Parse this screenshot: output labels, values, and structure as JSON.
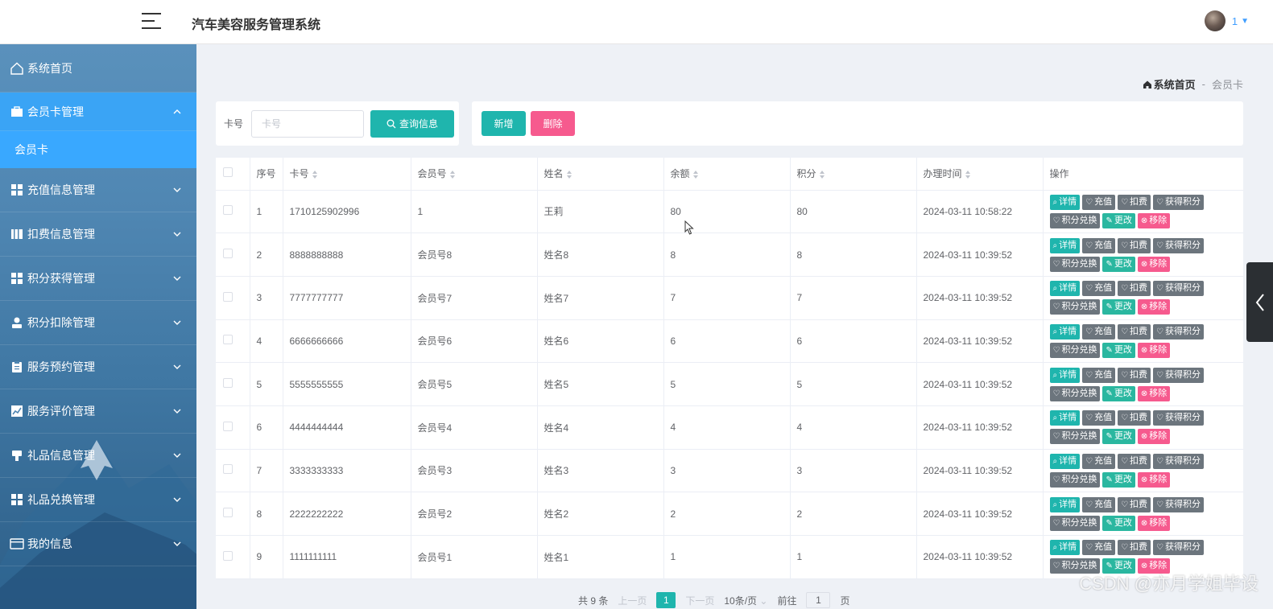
{
  "app": {
    "title": "汽车美容服务管理系统",
    "user_name": "1"
  },
  "sidebar": {
    "items": [
      {
        "label": "系统首页",
        "icon": "home-icon"
      },
      {
        "label": "会员卡管理",
        "icon": "briefcase-icon",
        "expanded": true,
        "sub": [
          {
            "label": "会员卡"
          }
        ]
      },
      {
        "label": "充值信息管理",
        "icon": "grid-icon"
      },
      {
        "label": "扣费信息管理",
        "icon": "book-icon"
      },
      {
        "label": "积分获得管理",
        "icon": "grid-icon"
      },
      {
        "label": "积分扣除管理",
        "icon": "user-icon"
      },
      {
        "label": "服务预约管理",
        "icon": "clipboard-icon"
      },
      {
        "label": "服务评价管理",
        "icon": "chart-icon"
      },
      {
        "label": "礼品信息管理",
        "icon": "stamp-icon"
      },
      {
        "label": "礼品兑换管理",
        "icon": "grid-icon"
      },
      {
        "label": "我的信息",
        "icon": "id-card-icon"
      }
    ]
  },
  "breadcrumb": {
    "home": "系统首页",
    "sep": "-",
    "current": "会员卡"
  },
  "search": {
    "label": "卡号",
    "placeholder": "卡号",
    "button": "查询信息"
  },
  "actions": {
    "add": "新增",
    "delete": "删除"
  },
  "table": {
    "columns": [
      "序号",
      "卡号",
      "会员号",
      "姓名",
      "余额",
      "积分",
      "办理时间",
      "操作"
    ],
    "ops": {
      "detail": "详情",
      "recharge": "充值",
      "deduct": "扣费",
      "gain_points": "获得积分",
      "redeem_points": "积分兑换",
      "edit": "更改",
      "remove": "移除"
    },
    "rows": [
      {
        "idx": "1",
        "card": "1710125902996",
        "member": "1",
        "name": "王莉",
        "balance": "80",
        "points": "80",
        "time": "2024-03-11 10:58:22"
      },
      {
        "idx": "2",
        "card": "8888888888",
        "member": "会员号8",
        "name": "姓名8",
        "balance": "8",
        "points": "8",
        "time": "2024-03-11 10:39:52"
      },
      {
        "idx": "3",
        "card": "7777777777",
        "member": "会员号7",
        "name": "姓名7",
        "balance": "7",
        "points": "7",
        "time": "2024-03-11 10:39:52"
      },
      {
        "idx": "4",
        "card": "6666666666",
        "member": "会员号6",
        "name": "姓名6",
        "balance": "6",
        "points": "6",
        "time": "2024-03-11 10:39:52"
      },
      {
        "idx": "5",
        "card": "5555555555",
        "member": "会员号5",
        "name": "姓名5",
        "balance": "5",
        "points": "5",
        "time": "2024-03-11 10:39:52"
      },
      {
        "idx": "6",
        "card": "4444444444",
        "member": "会员号4",
        "name": "姓名4",
        "balance": "4",
        "points": "4",
        "time": "2024-03-11 10:39:52"
      },
      {
        "idx": "7",
        "card": "3333333333",
        "member": "会员号3",
        "name": "姓名3",
        "balance": "3",
        "points": "3",
        "time": "2024-03-11 10:39:52"
      },
      {
        "idx": "8",
        "card": "2222222222",
        "member": "会员号2",
        "name": "姓名2",
        "balance": "2",
        "points": "2",
        "time": "2024-03-11 10:39:52"
      },
      {
        "idx": "9",
        "card": "1111111111",
        "member": "会员号1",
        "name": "姓名1",
        "balance": "1",
        "points": "1",
        "time": "2024-03-11 10:39:52"
      }
    ]
  },
  "pagination": {
    "total": "共 9 条",
    "prev": "上一页",
    "current": "1",
    "next": "下一页",
    "page_size": "10条/页",
    "goto": "前往",
    "goto_value": "1",
    "page_unit": "页"
  },
  "watermark": "CSDN @亦月学姐毕设",
  "colors": {
    "primary": "#1fb5ad",
    "danger": "#f65a8e",
    "dark": "#6c757d",
    "link": "#409EFF"
  }
}
